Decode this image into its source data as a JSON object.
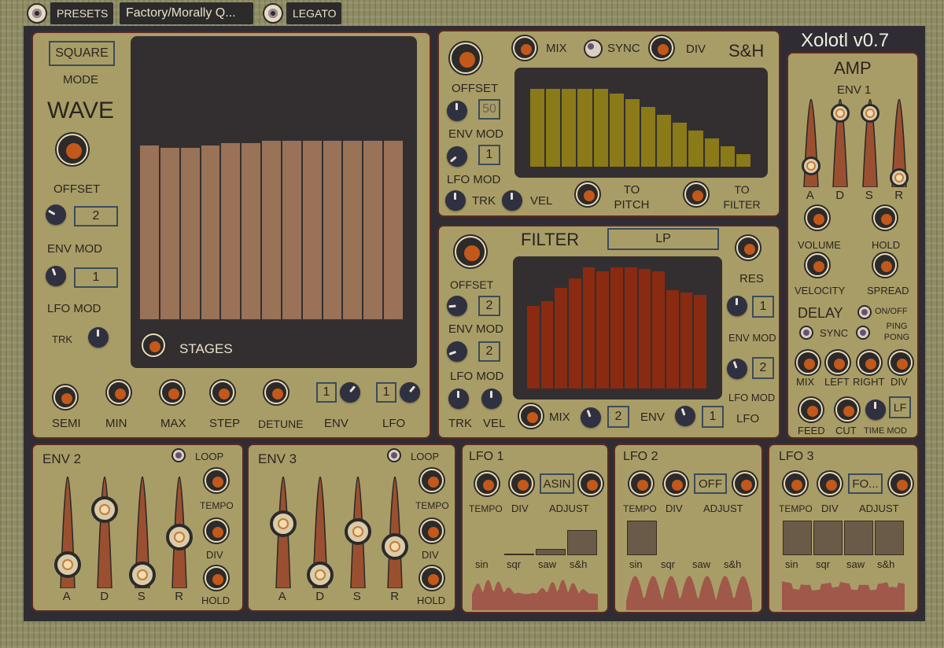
{
  "topbar": {
    "presets_label": "PRESETS",
    "preset_name": "Factory/Morally Q...",
    "legato_label": "LEGATO"
  },
  "app": {
    "title": "Xolotl v0.7"
  },
  "wave": {
    "mode_button": "SQUARE",
    "mode_label": "MODE",
    "title": "WAVE",
    "offset_label": "OFFSET",
    "offset_value": "2",
    "envmod_label": "ENV MOD",
    "envmod_value": "1",
    "lfomod_label": "LFO MOD",
    "trk_label": "TRK",
    "stages_label": "STAGES",
    "stage_levels": [
      0.69,
      0.68,
      0.68,
      0.69,
      0.7,
      0.7,
      0.71,
      0.71,
      0.71,
      0.71,
      0.71,
      0.71,
      0.71
    ],
    "bottom_labels": {
      "semi": "SEMI",
      "min": "MIN",
      "max": "MAX",
      "step": "STEP",
      "detune": "DETUNE",
      "env": "ENV",
      "lfo": "LFO"
    },
    "env_value": "1",
    "lfo_value": "1"
  },
  "sh": {
    "title": "S&H",
    "mix_label": "MIX",
    "sync_label": "SYNC",
    "div_label": "DIV",
    "offset_label": "OFFSET",
    "offset_value": "50",
    "envmod_label": "ENV MOD",
    "envmod_value": "1",
    "lfomod_label": "LFO MOD",
    "trk_label": "TRK",
    "vel_label": "VEL",
    "to_pitch": "TO PITCH",
    "to_filter": "TO FILTER",
    "step_levels": [
      0.88,
      0.88,
      0.88,
      0.88,
      0.88,
      0.83,
      0.77,
      0.68,
      0.59,
      0.5,
      0.41,
      0.32,
      0.23,
      0.14
    ],
    "bar_color": "#8a7a18"
  },
  "filter": {
    "title": "FILTER",
    "type": "LP",
    "offset_label": "OFFSET",
    "offset_value": "2",
    "envmod_label": "ENV MOD",
    "envmod_value": "2",
    "lfomod_label": "LFO MOD",
    "trk_label": "TRK",
    "vel_label": "VEL",
    "res_label": "RES",
    "res_value": "1",
    "env_mod_r_label": "ENV MOD",
    "env_mod_r_value": "2",
    "lfo_mod_r_label": "LFO MOD",
    "mix_label": "MIX",
    "mix_value": "2",
    "env_label": "ENV",
    "env_value": "1",
    "lfo_label": "LFO",
    "bar_levels": [
      0.68,
      0.72,
      0.83,
      0.91,
      1.0,
      0.97,
      1.0,
      1.0,
      0.99,
      0.97,
      0.81,
      0.79,
      0.77
    ],
    "bar_color": "#8a2a10"
  },
  "amp": {
    "title": "AMP",
    "env_label": "ENV 1",
    "adsr": [
      "A",
      "D",
      "S",
      "R"
    ],
    "adsr_levels": [
      0.17,
      0.93,
      0.93,
      0.0
    ],
    "volume_label": "VOLUME",
    "hold_label": "HOLD",
    "velocity_label": "VELOCITY",
    "spread_label": "SPREAD",
    "delay_label": "DELAY",
    "onoff_label": "ON/OFF",
    "sync_label": "SYNC",
    "pingpong_label": "PING PONG",
    "mix_label": "MIX",
    "left_label": "LEFT",
    "right_label": "RIGHT",
    "div_label": "DIV",
    "feed_label": "FEED",
    "cut_label": "CUT",
    "timemod_label": "TIME MOD",
    "lf_value": "LF"
  },
  "env2": {
    "title": "ENV 2",
    "loop_label": "LOOP",
    "tempo_label": "TEMPO",
    "div_label": "DIV",
    "hold_label": "HOLD",
    "adsr": [
      "A",
      "D",
      "S",
      "R"
    ],
    "adsr_levels": [
      0.12,
      0.77,
      0.0,
      0.44
    ]
  },
  "env3": {
    "title": "ENV 3",
    "loop_label": "LOOP",
    "tempo_label": "TEMPO",
    "div_label": "DIV",
    "hold_label": "HOLD",
    "adsr": [
      "A",
      "D",
      "S",
      "R"
    ],
    "adsr_levels": [
      0.6,
      0.0,
      0.51,
      0.33
    ]
  },
  "lfo1": {
    "title": "LFO 1",
    "shape": "ASIN",
    "tempo_label": "TEMPO",
    "div_label": "DIV",
    "adjust_label": "ADJUST",
    "waves": [
      "sin",
      "sqr",
      "saw",
      "s&h"
    ],
    "bar_color": "#6a5a48"
  },
  "lfo2": {
    "title": "LFO 2",
    "shape": "OFF",
    "tempo_label": "TEMPO",
    "div_label": "DIV",
    "adjust_label": "ADJUST",
    "waves": [
      "sin",
      "sqr",
      "saw",
      "s&h"
    ]
  },
  "lfo3": {
    "title": "LFO 3",
    "shape": "FO...",
    "tempo_label": "TEMPO",
    "div_label": "DIV",
    "adjust_label": "ADJUST",
    "waves": [
      "sin",
      "sqr",
      "saw",
      "s&h"
    ]
  },
  "colors": {
    "panel": "#a99d67",
    "panel_border": "#5a2a20",
    "screen": "#332f30",
    "wave_bars": "#9a7258",
    "knob_accent": "#c2581a",
    "envelope_slider": "#9a5030",
    "lfo_wave": "#a0584a"
  }
}
